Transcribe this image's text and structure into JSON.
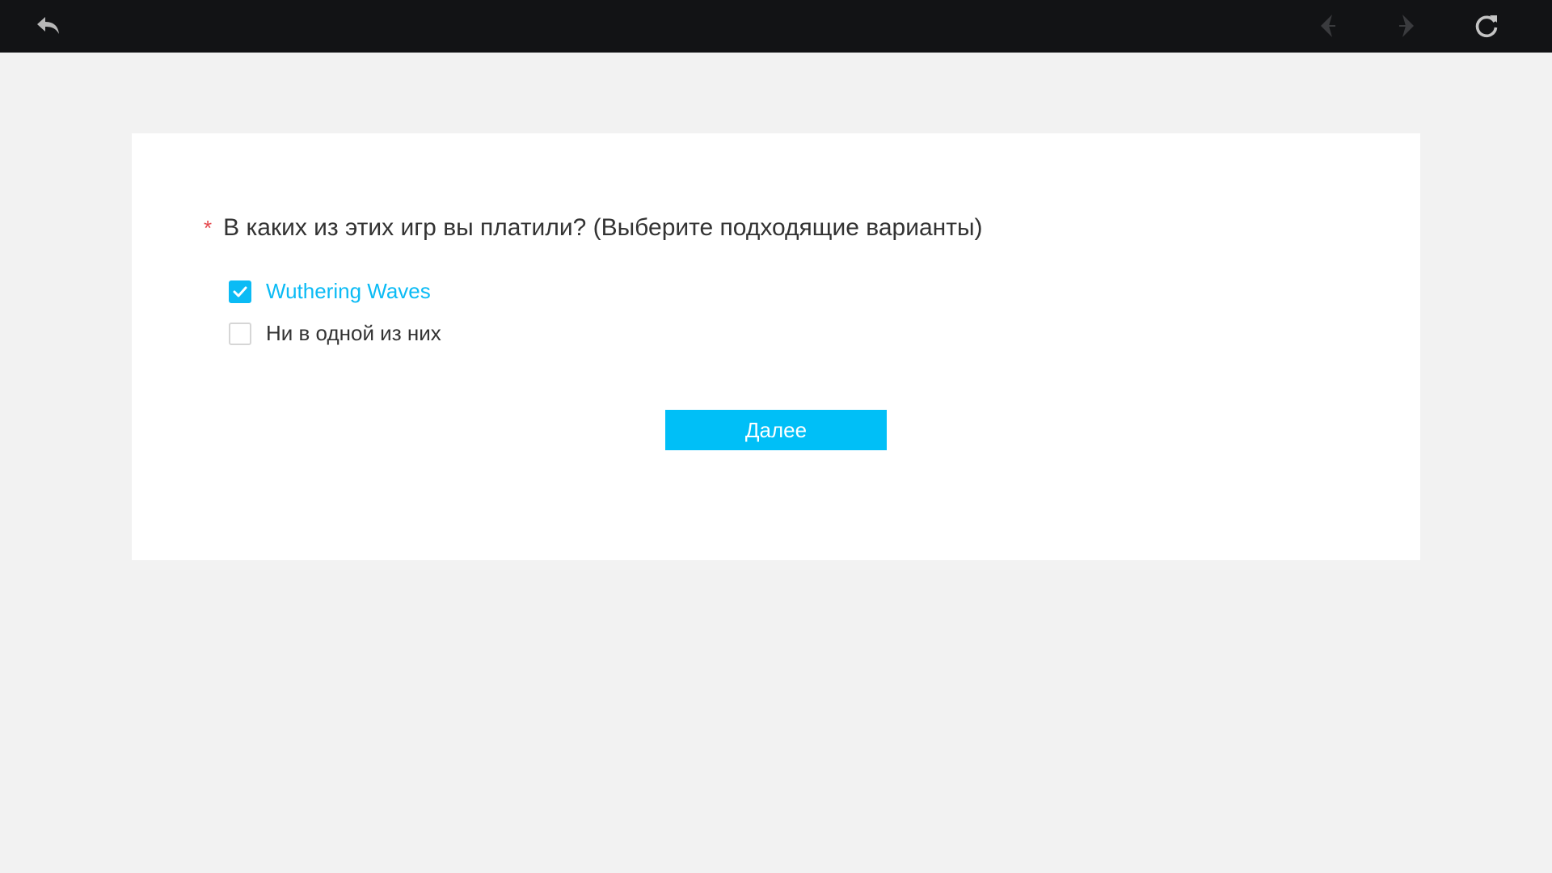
{
  "toolbar": {
    "back_icon": "undo-arrow-icon",
    "prev_icon": "arrow-left-icon",
    "next_icon": "arrow-right-icon",
    "reload_icon": "reload-icon"
  },
  "survey": {
    "required_mark": "*",
    "question": "В каких из этих игр вы платили? (Выберите подходящие варианты)",
    "options": [
      {
        "label": "Wuthering Waves",
        "checked": true
      },
      {
        "label": "Ни в одной из них",
        "checked": false
      }
    ],
    "next_label": "Далее"
  },
  "colors": {
    "topbar": "#121315",
    "accent": "#0bbbf5",
    "required": "#e5484d",
    "background": "#f2f2f2"
  }
}
